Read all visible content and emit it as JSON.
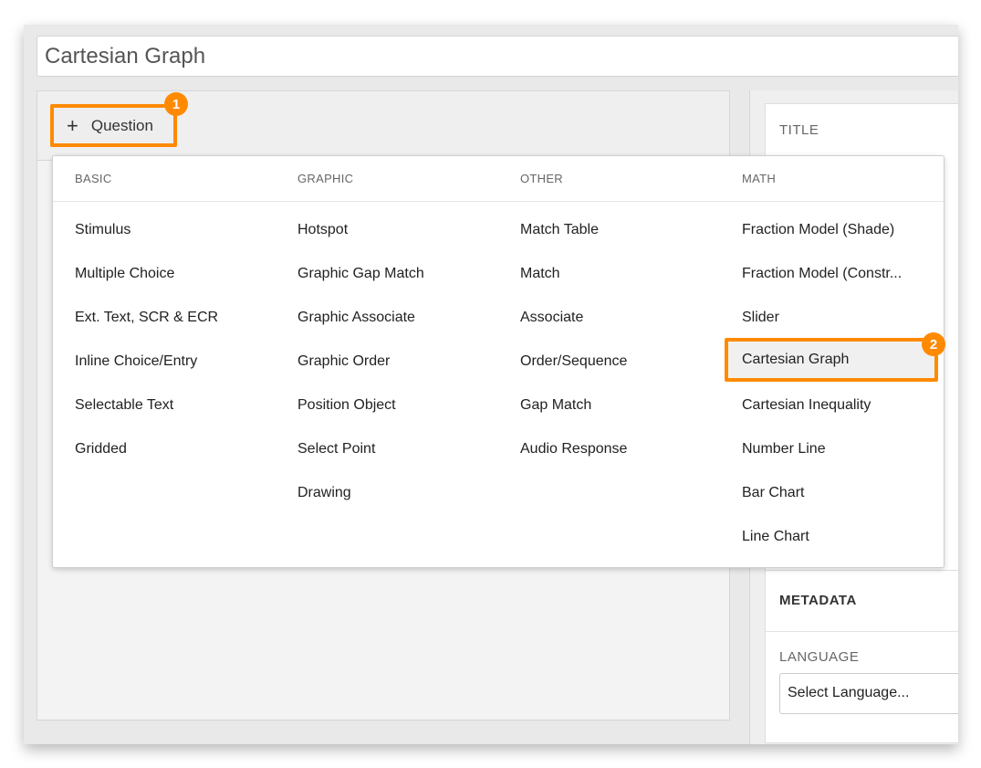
{
  "title_field": {
    "value": "Cartesian Graph"
  },
  "toolbar": {
    "add_question_label": "Question"
  },
  "callouts": [
    "1",
    "2"
  ],
  "right_panel": {
    "title_label": "TITLE",
    "metadata_title": "METADATA",
    "language_label": "LANGUAGE",
    "language_select": "Select Language..."
  },
  "accent_color": "#ff8a00",
  "menu": {
    "columns": [
      {
        "header": "BASIC",
        "items": [
          "Stimulus",
          "Multiple Choice",
          "Ext. Text, SCR & ECR",
          "Inline Choice/Entry",
          "Selectable Text",
          "Gridded"
        ]
      },
      {
        "header": "GRAPHIC",
        "items": [
          "Hotspot",
          "Graphic Gap Match",
          "Graphic Associate",
          "Graphic Order",
          "Position Object",
          "Select Point",
          "Drawing"
        ]
      },
      {
        "header": "OTHER",
        "items": [
          "Match Table",
          "Match",
          "Associate",
          "Order/Sequence",
          "Gap Match",
          "Audio Response"
        ]
      },
      {
        "header": "MATH",
        "items": [
          "Fraction Model (Shade)",
          "Fraction Model (Constr...",
          "Slider",
          "Cartesian Graph",
          "Cartesian Inequality",
          "Number Line",
          "Bar Chart",
          "Line Chart"
        ],
        "selected": "Cartesian Graph"
      }
    ]
  }
}
